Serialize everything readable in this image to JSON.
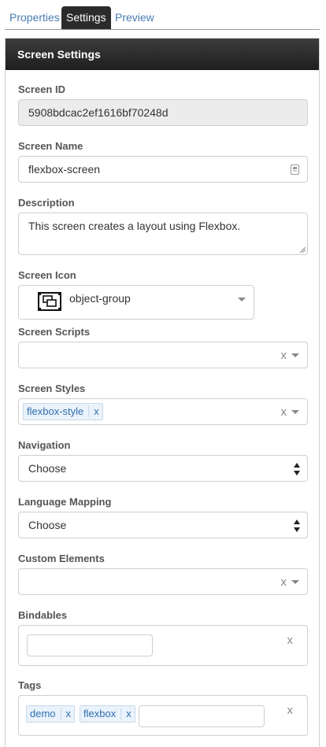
{
  "tabs": [
    {
      "label": "Properties",
      "active": false
    },
    {
      "label": "Settings",
      "active": true
    },
    {
      "label": "Preview",
      "active": false
    }
  ],
  "panel": {
    "title": "Screen Settings",
    "screen_id": {
      "label": "Screen ID",
      "value": "5908bdcac2ef1616bf70248d"
    },
    "screen_name": {
      "label": "Screen Name",
      "value": "flexbox-screen"
    },
    "description": {
      "label": "Description",
      "value": "This screen creates a layout using Flexbox."
    },
    "screen_icon": {
      "label": "Screen Icon",
      "value": "object-group",
      "icon": "object-group-icon"
    },
    "screen_scripts": {
      "label": "Screen Scripts",
      "clear": "x"
    },
    "screen_styles": {
      "label": "Screen Styles",
      "tags": [
        {
          "text": "flexbox-style",
          "remove": "x"
        }
      ],
      "clear": "x"
    },
    "navigation": {
      "label": "Navigation",
      "value": "Choose"
    },
    "language_mapping": {
      "label": "Language Mapping",
      "value": "Choose"
    },
    "custom_elements": {
      "label": "Custom Elements",
      "clear": "x"
    },
    "bindables": {
      "label": "Bindables",
      "clear": "x"
    },
    "tags_field": {
      "label": "Tags",
      "tags": [
        {
          "text": "demo",
          "remove": "x"
        },
        {
          "text": "flexbox",
          "remove": "x"
        }
      ],
      "clear": "x"
    }
  },
  "colors": {
    "accent": "#2f6fb0",
    "header": "#2b2b2b",
    "tab_link": "#4a7db5"
  }
}
